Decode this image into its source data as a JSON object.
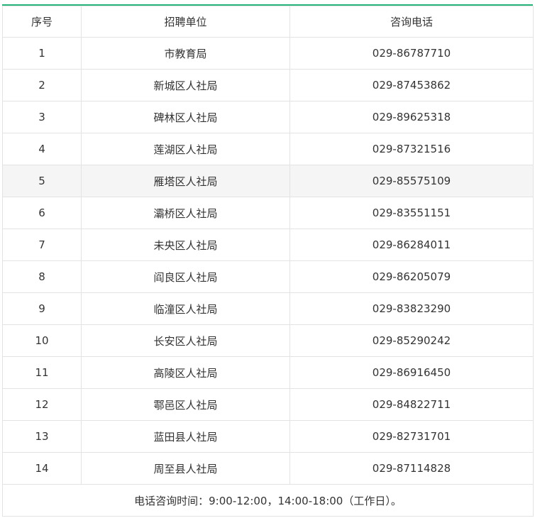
{
  "table": {
    "headers": [
      "序号",
      "招聘单位",
      "咨询电话"
    ],
    "rows": [
      {
        "no": "1",
        "unit": "市教育局",
        "phone": "029-86787710"
      },
      {
        "no": "2",
        "unit": "新城区人社局",
        "phone": "029-87453862"
      },
      {
        "no": "3",
        "unit": "碑林区人社局",
        "phone": "029-89625318"
      },
      {
        "no": "4",
        "unit": "莲湖区人社局",
        "phone": "029-87321516"
      },
      {
        "no": "5",
        "unit": "雁塔区人社局",
        "phone": "029-85575109"
      },
      {
        "no": "6",
        "unit": "灞桥区人社局",
        "phone": "029-83551151"
      },
      {
        "no": "7",
        "unit": "未央区人社局",
        "phone": "029-86284011"
      },
      {
        "no": "8",
        "unit": "阎良区人社局",
        "phone": "029-86205079"
      },
      {
        "no": "9",
        "unit": "临潼区人社局",
        "phone": "029-83823290"
      },
      {
        "no": "10",
        "unit": "长安区人社局",
        "phone": "029-85290242"
      },
      {
        "no": "11",
        "unit": "高陵区人社局",
        "phone": "029-86916450"
      },
      {
        "no": "12",
        "unit": "鄠邑区人社局",
        "phone": "029-84822711"
      },
      {
        "no": "13",
        "unit": "蓝田县人社局",
        "phone": "029-82731701"
      },
      {
        "no": "14",
        "unit": "周至县人社局",
        "phone": "029-87114828"
      }
    ],
    "note": "电话咨询时间：9:00-12:00，14:00-18:00（工作日）。"
  },
  "colors": {
    "accent": "#27b47a",
    "border": "#e3e3e3",
    "highlight_row": "#f5f5f5",
    "text": "#333333"
  }
}
